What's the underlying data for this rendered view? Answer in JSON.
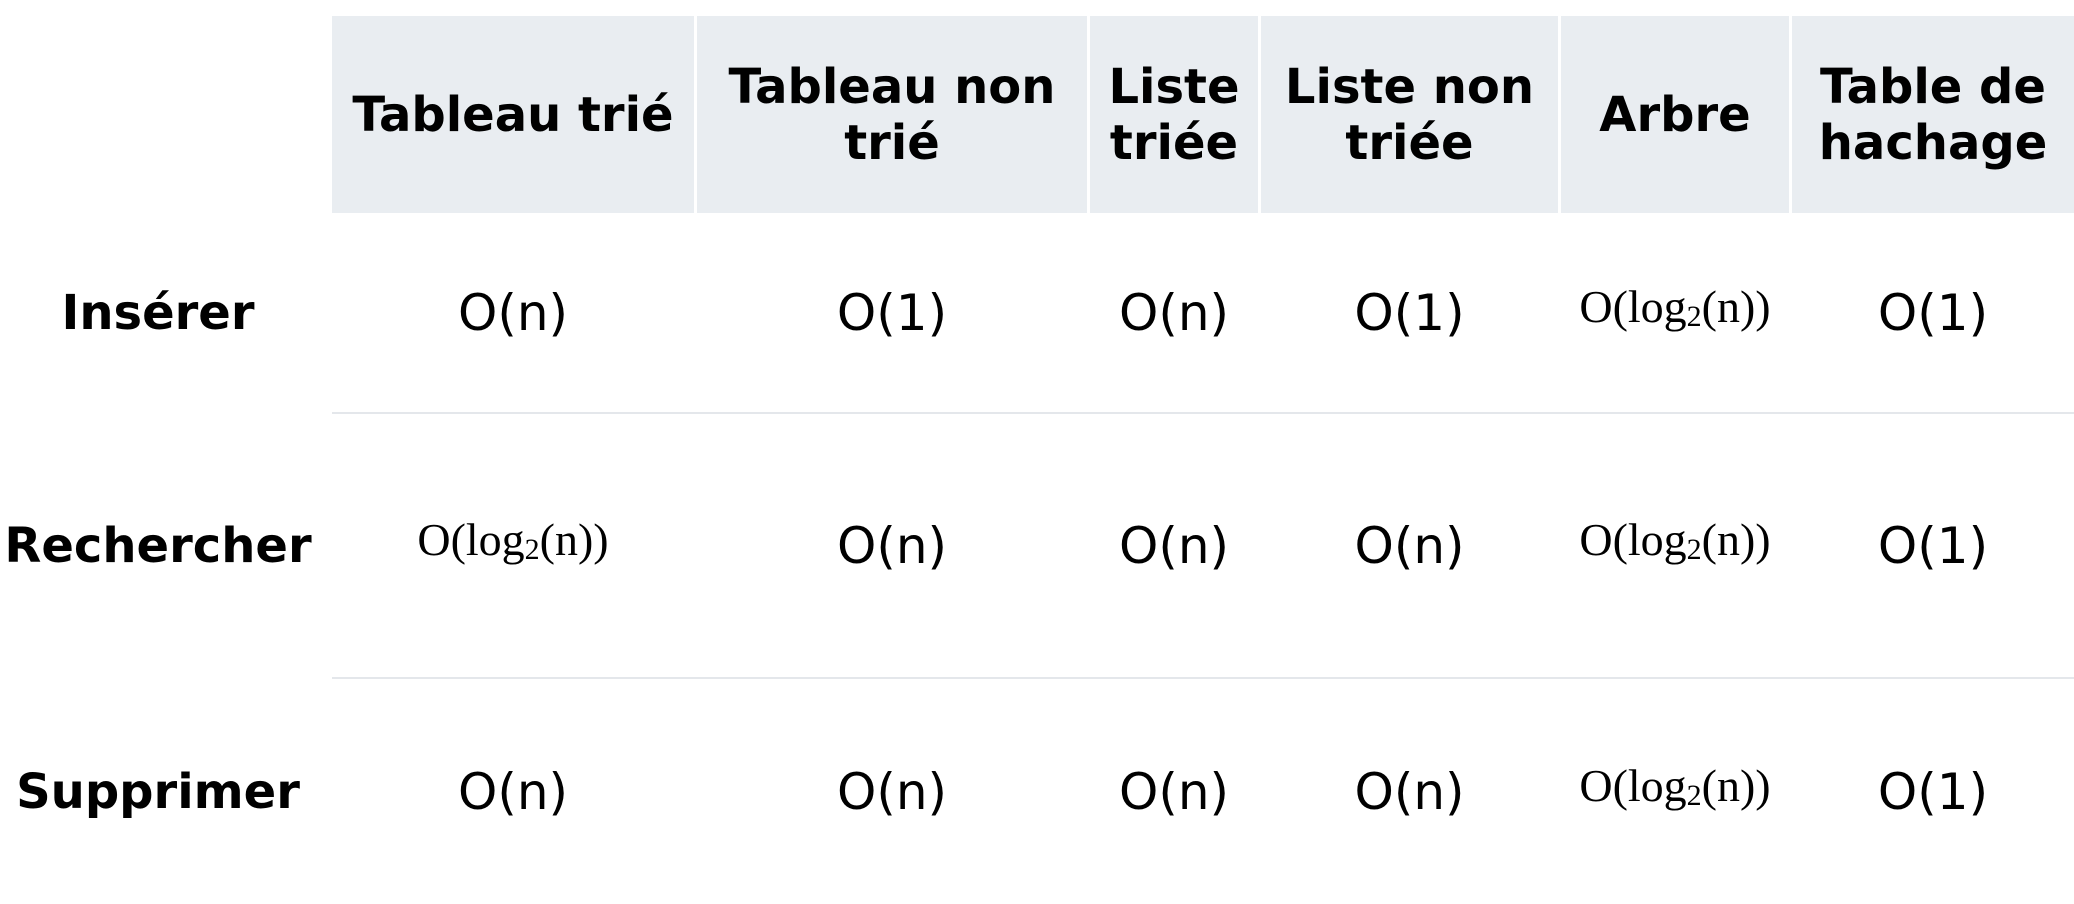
{
  "table": {
    "columns": [
      "Tableau trié",
      "Tableau non\ntrié",
      "Liste\ntriée",
      "Liste non\ntriée",
      "Arbre",
      "Table de\nhachage"
    ],
    "rows": [
      {
        "label": "Insérer",
        "cells": [
          "O(n)",
          "O(1)",
          "O(n)",
          "O(1)",
          "O(log2(n))",
          "O(1)"
        ]
      },
      {
        "label": "Rechercher",
        "cells": [
          "O(log2(n))",
          "O(n)",
          "O(n)",
          "O(n)",
          "O(log2(n))",
          "O(1)"
        ]
      },
      {
        "label": "Supprimer",
        "cells": [
          "O(n)",
          "O(n)",
          "O(n)",
          "O(n)",
          "O(log2(n))",
          "O(1)"
        ]
      }
    ]
  },
  "colors": {
    "header_background": "#e9edf1",
    "row_separator": "#e4e7eb",
    "text": "#000000"
  }
}
